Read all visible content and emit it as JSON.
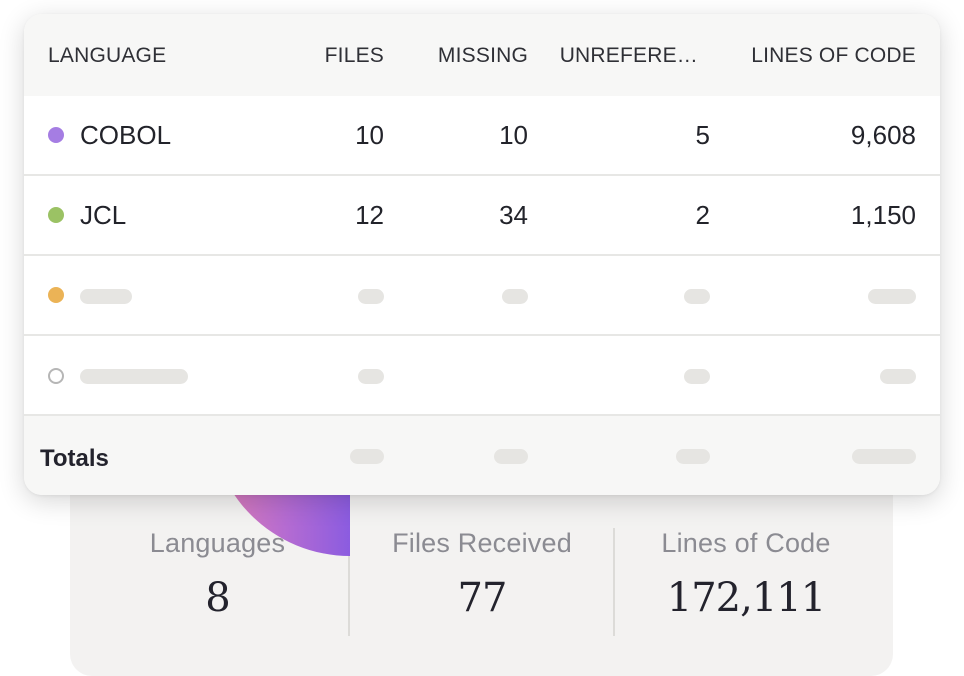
{
  "table": {
    "headers": {
      "language": "LANGUAGE",
      "files": "FILES",
      "missing": "MISSING",
      "unreferenced": "UNREFERE…",
      "lines_of_code": "LINES OF CODE"
    },
    "rows": [
      {
        "language": "COBOL",
        "dot_color": "#a57de3",
        "files": "10",
        "missing": "10",
        "unreferenced": "5",
        "lines_of_code": "9,608"
      },
      {
        "language": "JCL",
        "dot_color": "#9bc264",
        "files": "12",
        "missing": "34",
        "unreferenced": "2",
        "lines_of_code": "1,150"
      },
      {
        "language": "",
        "dot_color": "#ebb356",
        "placeholder": true
      },
      {
        "language": "",
        "dot_color": "#ffffff",
        "placeholder": true
      }
    ],
    "totals_label": "Totals"
  },
  "stats": {
    "languages": {
      "label": "Languages",
      "value": "8"
    },
    "files_received": {
      "label": "Files Received",
      "value": "77"
    },
    "lines_of_code": {
      "label": "Lines of Code",
      "value": "172,111"
    }
  }
}
